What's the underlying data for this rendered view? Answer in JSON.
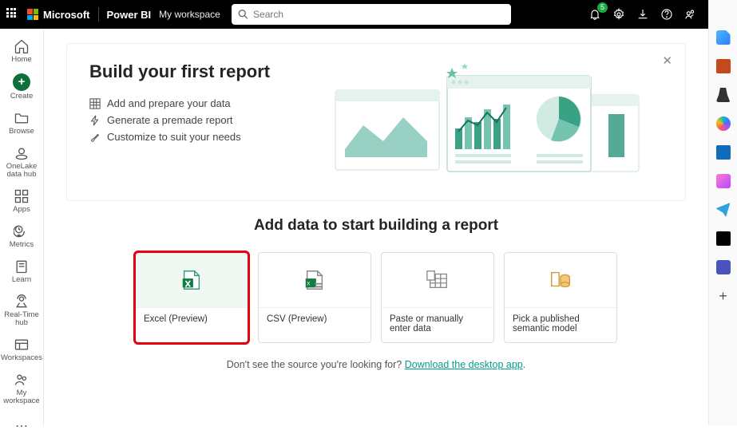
{
  "header": {
    "brand": "Microsoft",
    "product": "Power BI",
    "workspace": "My workspace",
    "search_placeholder": "Search",
    "notification_count": "5"
  },
  "leftnav": {
    "items": [
      {
        "label": "Home"
      },
      {
        "label": "Create"
      },
      {
        "label": "Browse"
      },
      {
        "label": "OneLake data hub"
      },
      {
        "label": "Apps"
      },
      {
        "label": "Metrics"
      },
      {
        "label": "Learn"
      },
      {
        "label": "Real-Time hub"
      },
      {
        "label": "Workspaces"
      },
      {
        "label": "My workspace"
      }
    ]
  },
  "hero": {
    "title": "Build your first report",
    "steps": [
      "Add and prepare your data",
      "Generate a premade report",
      "Customize to suit your needs"
    ]
  },
  "section": {
    "heading": "Add data to start building a report"
  },
  "cards": [
    {
      "label": "Excel (Preview)"
    },
    {
      "label": "CSV (Preview)"
    },
    {
      "label": "Paste or manually enter data"
    },
    {
      "label": "Pick a published semantic model"
    }
  ],
  "footer": {
    "prefix": "Don't see the source you're looking for? ",
    "link": "Download the desktop app",
    "suffix": "."
  }
}
